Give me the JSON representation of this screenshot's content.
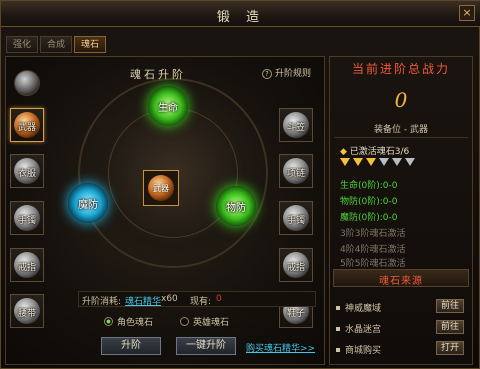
{
  "window": {
    "title": "锻 造"
  },
  "tabs": [
    {
      "label": "强化"
    },
    {
      "label": "合成"
    },
    {
      "label": "魂石",
      "active": true
    }
  ],
  "section": {
    "title": "魂石升阶",
    "rules_link": "升阶规则"
  },
  "left_slots": [
    {
      "label": "武器",
      "active": true
    },
    {
      "label": "衣服"
    },
    {
      "label": "手镯"
    },
    {
      "label": "戒指"
    },
    {
      "label": "腰带"
    }
  ],
  "right_slots": [
    {
      "label": "斗笠"
    },
    {
      "label": "项链"
    },
    {
      "label": "手镯"
    },
    {
      "label": "戒指"
    },
    {
      "label": "鞋子"
    }
  ],
  "gems": {
    "life": "生命",
    "magic_def": "魔防",
    "phys_def": "物防",
    "center": "武器"
  },
  "cost": {
    "label": "升阶消耗:",
    "item": "魂石精华",
    "count": "x60",
    "owned_label": "现有:",
    "owned_value": "0"
  },
  "radios": [
    {
      "label": "角色魂石",
      "checked": true
    },
    {
      "label": "英雄魂石",
      "checked": false
    }
  ],
  "buttons": {
    "upgrade": "升阶",
    "one_click": "一键升阶"
  },
  "buy_link": "购买魂石精华>>",
  "right_panel": {
    "title": "当前进阶总战力",
    "power": "0",
    "equip": "装备位 - 武器",
    "activated": "已激活魂石3/6",
    "diamonds": {
      "gold": 3,
      "gray": 3
    },
    "stats": [
      "生命(0阶):0-0",
      "物防(0阶):0-0",
      "魔防(0阶):0-0"
    ],
    "locked": [
      "3阶3阶魂石激活",
      "4阶4阶魂石激活",
      "5阶5阶魂石激活"
    ],
    "source_title": "魂石来源",
    "sources": [
      {
        "name": "神威魔域",
        "action": "前往"
      },
      {
        "name": "水晶迷宫",
        "action": "前往"
      },
      {
        "name": "商城购买",
        "action": "打开"
      }
    ]
  },
  "colors": {
    "accent": "#f0593a",
    "gold": "#f4b43a",
    "link": "#42c7e6",
    "stat": "#4fd33a"
  },
  "icons": {
    "close": "close-icon",
    "rules": "question-icon"
  }
}
